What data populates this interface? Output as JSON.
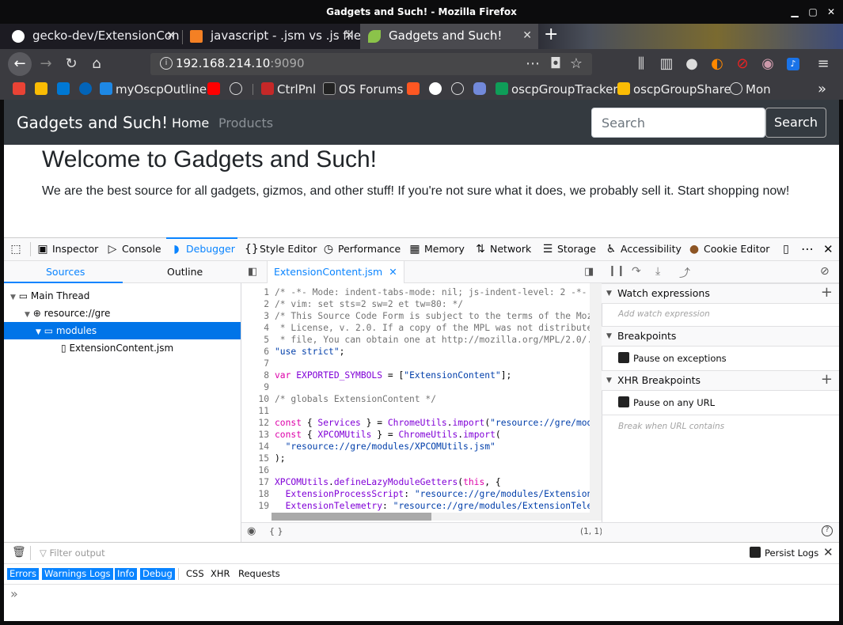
{
  "window": {
    "title": "Gadgets and Such! - Mozilla Firefox"
  },
  "tabs": [
    {
      "label": "gecko-dev/ExtensionCon",
      "icon": "github-icon"
    },
    {
      "label": "javascript - .jsm vs .js file",
      "icon": "stackoverflow-icon"
    },
    {
      "label": "Gadgets and Such!",
      "icon": "leaf-icon"
    }
  ],
  "url": {
    "host": "192.168.214.10",
    "port": ":9090"
  },
  "bookmarks": [
    "myOscpOutline",
    "CtrlPnl",
    "OS Forums",
    "oscpGroupTracker",
    "oscpGroupShare",
    "Mon"
  ],
  "site": {
    "brand": "Gadgets and Such!",
    "nav_home": "Home",
    "nav_products": "Products",
    "search_placeholder": "Search",
    "search_button": "Search",
    "hero_title": "Welcome to Gadgets and Such!",
    "hero_text": "We are the best source for all gadgets, gizmos, and other stuff! If you're not sure what it does, we probably sell it. Start shopping now!"
  },
  "devtools": {
    "tools": [
      "Inspector",
      "Console",
      "Debugger",
      "Style Editor",
      "Performance",
      "Memory",
      "Network",
      "Storage",
      "Accessibility",
      "Cookie Editor"
    ],
    "source_tabs": {
      "sources": "Sources",
      "outline": "Outline"
    },
    "tree": [
      "Main Thread",
      "resource://gre",
      "modules",
      "ExtensionContent.jsm"
    ],
    "editor_tab": "ExtensionContent.jsm",
    "cursor_pos": "(1, 1)",
    "right": {
      "watch": "Watch expressions",
      "watch_placeholder": "Add watch expression",
      "breakpoints": "Breakpoints",
      "pause_exceptions": "Pause on exceptions",
      "xhr": "XHR Breakpoints",
      "pause_url": "Pause on any URL",
      "break_url": "Break when URL contains"
    },
    "console": {
      "filter_placeholder": "Filter output",
      "persist": "Persist Logs",
      "filters_on": [
        "Errors",
        "Warnings",
        "Logs",
        "Info",
        "Debug"
      ],
      "filters_off": [
        "CSS",
        "XHR",
        "Requests"
      ]
    }
  }
}
